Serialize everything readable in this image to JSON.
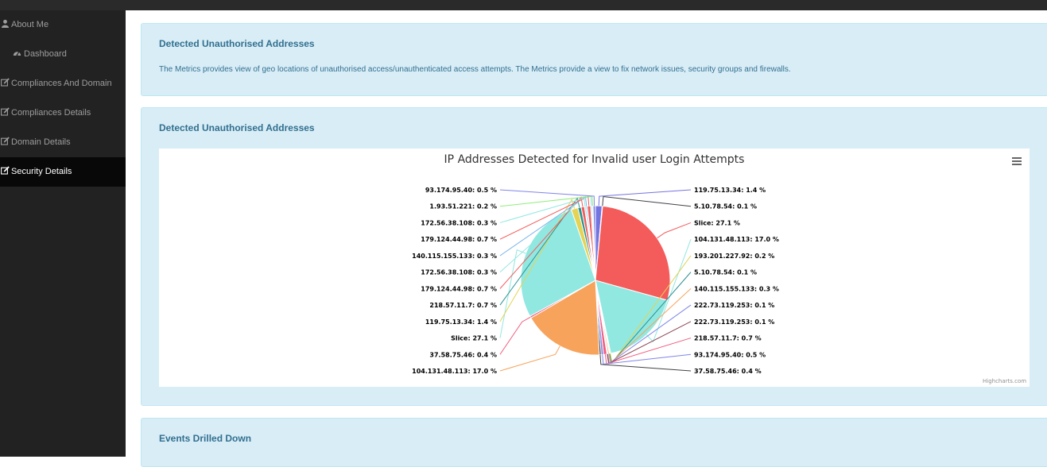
{
  "sidebar": {
    "items": [
      {
        "label": "About Me",
        "icon": "user-icon"
      },
      {
        "label": "Dashboard",
        "icon": "dashboard-icon"
      },
      {
        "label": "Compliances And Domain",
        "icon": "edit-icon"
      },
      {
        "label": "Compliances Details",
        "icon": "edit-icon"
      },
      {
        "label": "Domain Details",
        "icon": "edit-icon"
      },
      {
        "label": "Security Details",
        "icon": "edit-icon",
        "active": true
      }
    ]
  },
  "panels": {
    "info": {
      "title": "Detected Unauthorised Addresses",
      "text": "The Metrics provides view of geo locations of unauthorised access/unauthenticated access attempts. The Metrics provide a view to fix network issues, security groups and firewalls."
    },
    "chart": {
      "title": "Detected Unauthorised Addresses"
    },
    "events": {
      "title": "Events Drilled Down"
    }
  },
  "colors": {
    "panel_bg": "#d9edf7",
    "panel_text": "#31708f",
    "sidebar_bg": "#222222"
  },
  "chart_data": {
    "type": "pie",
    "title": "IP Addresses Detected for Invalid user Login Attempts",
    "credits": "Highcharts.com",
    "series": [
      {
        "name": "119.75.13.34",
        "value": 1.4,
        "color": "#7474e0"
      },
      {
        "name": "5.10.78.54",
        "value": 0.1,
        "color": "#434348"
      },
      {
        "name": "Slice",
        "value": 27.1,
        "color": "#f45b5b"
      },
      {
        "name": "104.131.48.113",
        "value": 17.0,
        "color": "#91e8e1"
      },
      {
        "name": "193.201.227.92",
        "value": 0.2,
        "color": "#e4d354"
      },
      {
        "name": "5.10.78.54",
        "value": 0.1,
        "color": "#2b908f"
      },
      {
        "name": "140.115.155.133",
        "value": 0.3,
        "color": "#f7a35c"
      },
      {
        "name": "222.73.119.253",
        "value": 0.1,
        "color": "#8085e9"
      },
      {
        "name": "222.73.119.253",
        "value": 0.1,
        "color": "#8d4654"
      },
      {
        "name": "218.57.11.7",
        "value": 0.7,
        "color": "#f15c80"
      },
      {
        "name": "93.174.95.40",
        "value": 0.5,
        "color": "#8085e9"
      },
      {
        "name": "37.58.75.46",
        "value": 0.4,
        "color": "#434348"
      },
      {
        "name": "104.131.48.113",
        "value": 17.0,
        "color": "#f7a35c"
      },
      {
        "name": "37.58.75.46",
        "value": 0.4,
        "color": "#f15c80"
      },
      {
        "name": "Slice",
        "value": 27.1,
        "color": "#91e8e1"
      },
      {
        "name": "119.75.13.34",
        "value": 1.4,
        "color": "#e4d354"
      },
      {
        "name": "218.57.11.7",
        "value": 0.7,
        "color": "#2b908f"
      },
      {
        "name": "179.124.44.98",
        "value": 0.7,
        "color": "#f45b5b"
      },
      {
        "name": "172.56.38.108",
        "value": 0.3,
        "color": "#91e8e1"
      },
      {
        "name": "140.115.155.133",
        "value": 0.3,
        "color": "#7cb5ec"
      },
      {
        "name": "179.124.44.98",
        "value": 0.7,
        "color": "#f45b5b"
      },
      {
        "name": "172.56.38.108",
        "value": 0.3,
        "color": "#91e8e1"
      },
      {
        "name": "1.93.51.221",
        "value": 0.2,
        "color": "#90ed7d"
      },
      {
        "name": "93.174.95.40",
        "value": 0.5,
        "color": "#8085e9"
      }
    ]
  }
}
